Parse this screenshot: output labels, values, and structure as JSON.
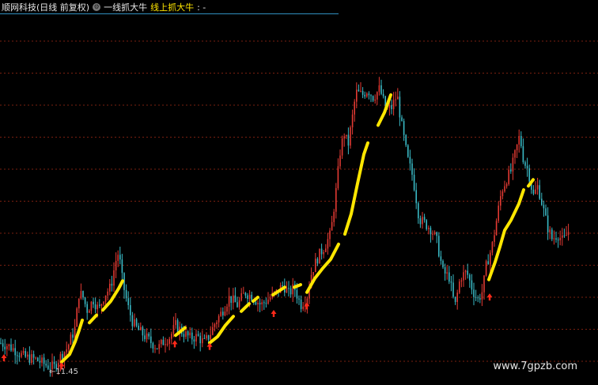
{
  "header": {
    "title": "顺网科技(日线 前复权)",
    "indicator_name": "一线抓大牛",
    "indicator_series": "线上抓大牛",
    "indicator_value": ": -",
    "settings_icon": "gear-icon"
  },
  "low_label": "←11.45",
  "watermark": "www.7gpzb.com",
  "colors": {
    "background": "#000000",
    "grid": "#7a1f10",
    "up": "#e23a33",
    "down": "#39b8c4",
    "signal": "#ffe600",
    "arrow": "#ff2a1a"
  },
  "chart_data": {
    "type": "candlestick",
    "series_name": "线上抓大牛",
    "grid": true,
    "low_price": 11.45,
    "price_path": [
      [
        0,
        13.4
      ],
      [
        10,
        13.2
      ],
      [
        20,
        12.8
      ],
      [
        30,
        12.3
      ],
      [
        45,
        12.1
      ],
      [
        60,
        11.6
      ],
      [
        68,
        11.45
      ],
      [
        75,
        12.2
      ],
      [
        85,
        13.0
      ],
      [
        95,
        14.6
      ],
      [
        100,
        17.4
      ],
      [
        105,
        17.0
      ],
      [
        110,
        16.0
      ],
      [
        118,
        16.8
      ],
      [
        125,
        16.0
      ],
      [
        132,
        17.2
      ],
      [
        140,
        17.8
      ],
      [
        146,
        19.8
      ],
      [
        150,
        20.6
      ],
      [
        155,
        18.2
      ],
      [
        162,
        16.2
      ],
      [
        168,
        15.0
      ],
      [
        175,
        14.4
      ],
      [
        182,
        14.0
      ],
      [
        190,
        13.5
      ],
      [
        200,
        13.0
      ],
      [
        208,
        13.6
      ],
      [
        215,
        13.9
      ],
      [
        222,
        14.8
      ],
      [
        230,
        14.3
      ],
      [
        240,
        13.8
      ],
      [
        250,
        13.9
      ],
      [
        258,
        13.4
      ],
      [
        265,
        14.0
      ],
      [
        272,
        15.0
      ],
      [
        280,
        15.8
      ],
      [
        290,
        17.0
      ],
      [
        300,
        16.4
      ],
      [
        310,
        17.4
      ],
      [
        320,
        17.0
      ],
      [
        330,
        16.4
      ],
      [
        340,
        16.9
      ],
      [
        350,
        17.4
      ],
      [
        358,
        18.0
      ],
      [
        365,
        17.3
      ],
      [
        372,
        17.8
      ],
      [
        380,
        16.4
      ],
      [
        388,
        17.0
      ],
      [
        394,
        19.0
      ],
      [
        402,
        20.2
      ],
      [
        410,
        21.0
      ],
      [
        418,
        22.0
      ],
      [
        425,
        25.5
      ],
      [
        430,
        28.5
      ],
      [
        435,
        30.0
      ],
      [
        440,
        29.0
      ],
      [
        445,
        31.0
      ],
      [
        450,
        33.2
      ],
      [
        458,
        33.0
      ],
      [
        465,
        33.4
      ],
      [
        472,
        32.8
      ],
      [
        480,
        33.5
      ],
      [
        488,
        31.8
      ],
      [
        495,
        32.0
      ],
      [
        502,
        33.0
      ],
      [
        508,
        30.5
      ],
      [
        515,
        28.0
      ],
      [
        522,
        26.5
      ],
      [
        530,
        23.2
      ],
      [
        538,
        22.8
      ],
      [
        545,
        22.4
      ],
      [
        552,
        21.5
      ],
      [
        560,
        19.0
      ],
      [
        568,
        18.6
      ],
      [
        575,
        16.2
      ],
      [
        582,
        18.6
      ],
      [
        590,
        19.0
      ],
      [
        598,
        17.5
      ],
      [
        604,
        16.8
      ],
      [
        610,
        17.5
      ],
      [
        615,
        19.6
      ],
      [
        622,
        21.0
      ],
      [
        628,
        23.2
      ],
      [
        634,
        25.4
      ],
      [
        640,
        26.3
      ],
      [
        646,
        27.0
      ],
      [
        652,
        28.5
      ],
      [
        657,
        29.8
      ],
      [
        662,
        27.8
      ],
      [
        668,
        27.0
      ],
      [
        674,
        25.0
      ],
      [
        680,
        25.8
      ],
      [
        686,
        24.2
      ],
      [
        692,
        22.6
      ],
      [
        698,
        21.6
      ],
      [
        705,
        22.0
      ],
      [
        712,
        21.4
      ],
      [
        718,
        22.2
      ]
    ],
    "signal_segments": [
      [
        [
          78,
          11.9
        ],
        [
          88,
          12.5
        ],
        [
          95,
          13.5
        ],
        [
          100,
          14.4
        ],
        [
          104,
          15.2
        ]
      ],
      [
        [
          113,
          15.0
        ],
        [
          122,
          15.6
        ]
      ],
      [
        [
          130,
          16.0
        ],
        [
          140,
          16.7
        ],
        [
          150,
          17.7
        ],
        [
          155,
          18.3
        ]
      ],
      [
        [
          222,
          14.0
        ],
        [
          234,
          14.6
        ]
      ],
      [
        [
          265,
          13.4
        ],
        [
          275,
          13.9
        ],
        [
          285,
          14.8
        ],
        [
          295,
          15.5
        ]
      ],
      [
        [
          305,
          15.9
        ],
        [
          315,
          16.5
        ]
      ],
      [
        [
          320,
          16.7
        ],
        [
          326,
          17.0
        ]
      ],
      [
        [
          345,
          17.2
        ],
        [
          360,
          17.8
        ]
      ],
      [
        [
          372,
          17.8
        ],
        [
          380,
          18.0
        ]
      ],
      [
        [
          388,
          17.4
        ],
        [
          398,
          18.5
        ],
        [
          408,
          19.3
        ],
        [
          418,
          20.0
        ],
        [
          428,
          21.2
        ]
      ],
      [
        [
          436,
          22.0
        ],
        [
          444,
          23.6
        ],
        [
          452,
          26.0
        ],
        [
          460,
          28.3
        ],
        [
          465,
          29.2
        ]
      ],
      [
        [
          478,
          30.6
        ],
        [
          486,
          31.6
        ],
        [
          494,
          33.0
        ]
      ],
      [
        [
          618,
          18.4
        ],
        [
          626,
          19.8
        ],
        [
          632,
          21.0
        ],
        [
          638,
          22.3
        ],
        [
          646,
          23.1
        ],
        [
          656,
          24.4
        ],
        [
          662,
          25.5
        ]
      ],
      [
        [
          668,
          25.8
        ],
        [
          674,
          26.3
        ]
      ]
    ],
    "buy_signals": [
      [
        5,
        12.2
      ],
      [
        78,
        11.55
      ],
      [
        221,
        13.3
      ],
      [
        265,
        13.1
      ],
      [
        346,
        15.7
      ],
      [
        388,
        16.3
      ],
      [
        619,
        17.0
      ]
    ]
  }
}
